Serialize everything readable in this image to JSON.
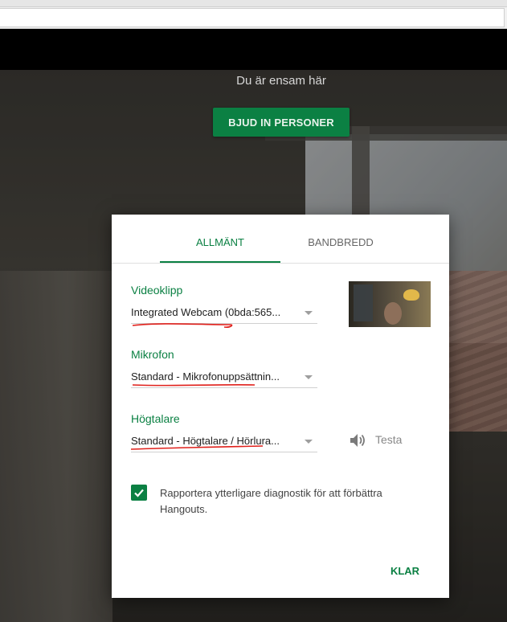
{
  "call": {
    "alone_message": "Du är ensam här",
    "invite_button_label": "BJUD IN PERSONER"
  },
  "dialog": {
    "tabs": [
      {
        "label": "ALLMÄNT",
        "active": true
      },
      {
        "label": "BANDBREDD",
        "active": false
      }
    ],
    "video": {
      "label": "Videoklipp",
      "selected": "Integrated Webcam (0bda:565..."
    },
    "microphone": {
      "label": "Mikrofon",
      "selected": "Standard - Mikrofonuppsättnin..."
    },
    "speaker": {
      "label": "Högtalare",
      "selected": "Standard - Högtalare / Hörlura...",
      "test_label": "Testa"
    },
    "diagnostics": {
      "checked": true,
      "label": "Rapportera ytterligare diagnostik för att förbättra Hangouts."
    },
    "done_label": "KLAR"
  },
  "colors": {
    "accent": "#0b8043",
    "annotation": "#e0201b"
  }
}
